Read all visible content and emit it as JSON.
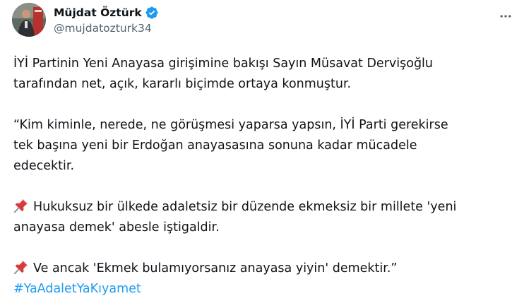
{
  "author": {
    "display_name": "Müjdat Öztürk",
    "handle": "@mujdatozturk34",
    "verified": true,
    "avatar_icon": "avatar-photo"
  },
  "actions": {
    "more_icon": "more-horizontal-icon"
  },
  "tweet": {
    "paragraph_1_line_1": "İYİ Partinin Yeni Anayasa girişimine bakışı Sayın Müsavat Dervişoğlu",
    "paragraph_1_line_2": "tarafından net, açık, kararlı biçimde ortaya konmuştur.",
    "paragraph_2_line_1": "“Kim kiminle, nerede, ne görüşmesi yaparsa yapsın, İYİ Parti gerekirse",
    "paragraph_2_line_2": "tek başına yeni bir Erdoğan anayasasına sonuna kadar mücadele",
    "paragraph_2_line_3": "edecektir.",
    "paragraph_3_line_1": "Hukuksuz bir ülkede adaletsiz bir düzende ekmeksiz bir millete 'yeni",
    "paragraph_3_line_2": "anayasa demek' abesle iştigaldir.",
    "paragraph_4_line_1": "Ve ancak 'Ekmek bulamıyorsanız anayasa yiyin' demektir.”",
    "hashtag": "#YaAdaletYaKıyamet",
    "pin_icon": "pushpin-icon"
  },
  "colors": {
    "text": "#0f1419",
    "secondary": "#536471",
    "link": "#1d9bf0",
    "verified": "#1d9bf0",
    "pin": "#d93a3a"
  }
}
